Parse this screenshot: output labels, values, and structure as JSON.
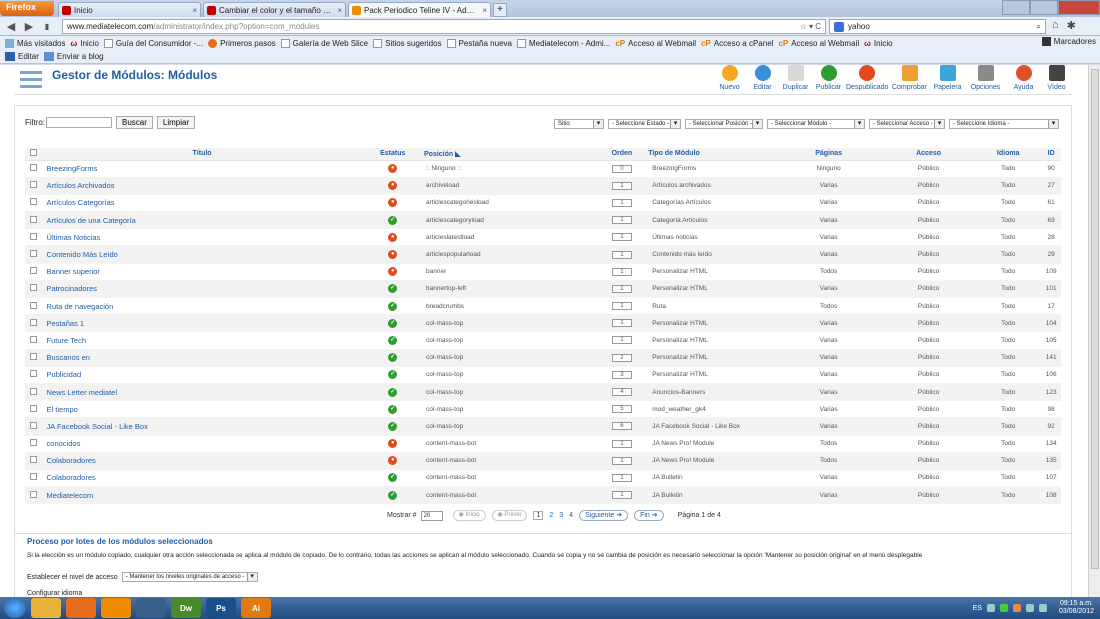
{
  "browser": {
    "app_button": "Firefox",
    "tabs": [
      {
        "title": "Inicio",
        "icon": "w-icon",
        "color": "#c00000"
      },
      {
        "title": "Cambiar el color y el tamaño del men...",
        "icon": "w-icon",
        "color": "#c00000"
      },
      {
        "title": "Pack Periodico Teline IV - Administra...",
        "icon": "joomla-icon",
        "color": "#f28b00",
        "active": true
      }
    ],
    "url_host": "www.mediatelecom.com",
    "url_path": "/administrator/index.php?option=com_modules",
    "search_value": "yahoo",
    "bookmarks": [
      "Más visitados",
      "Inicio",
      "Guía del Consumidor -...",
      "Primeros pasos",
      "Galería de Web Slice",
      "Sitios sugeridos",
      "Pestaña nueva",
      "Mediatelecom - Admi...",
      "Acceso al Webmail",
      "Acceso a cPanel",
      "Acceso al Webmail",
      "Inicio"
    ],
    "bookmarks_menu": "Marcadores",
    "toolbar2": [
      "Editar",
      "Enviar a blog"
    ]
  },
  "header": {
    "title": "Gestor de Módulos: Módulos",
    "buttons": [
      {
        "label": "Nuevo",
        "icon": "plus-icon",
        "color": "#f5a623"
      },
      {
        "label": "Editar",
        "icon": "edit-icon",
        "color": "#3b8fd9"
      },
      {
        "label": "Duplicar",
        "icon": "copy-icon",
        "color": "#bbbbbb"
      },
      {
        "label": "Publicar",
        "icon": "check-icon",
        "color": "#2f9d2f"
      },
      {
        "label": "Despublicado",
        "icon": "unpublish-icon",
        "color": "#e04a1c"
      },
      {
        "label": "Comprobar",
        "icon": "checkmark-icon",
        "color": "#f0a030"
      },
      {
        "label": "Papelera",
        "icon": "trash-icon",
        "color": "#3aa7d8"
      },
      {
        "label": "Opciones",
        "icon": "options-icon",
        "color": "#8a8a8a"
      },
      {
        "label": "Ayuda",
        "icon": "help-icon",
        "color": "#e0502a"
      },
      {
        "label": "Vídeo",
        "icon": "video-icon",
        "color": "#444444"
      }
    ]
  },
  "filter": {
    "label": "Filtro:",
    "value": "",
    "search_button": "Buscar",
    "clear_button": "Limpiar",
    "selects": [
      "Sitio",
      "- Seleccione Estado -",
      "- Seleccionar Posición -",
      "- Seleccionar Módulo -",
      "- Seleccionar Acceso -",
      "- Seleccione Idioma -"
    ]
  },
  "table": {
    "columns": [
      "Título",
      "Estatus",
      "Posición",
      "Orden",
      "Tipo de Módulo",
      "Páginas",
      "Acceso",
      "Idioma",
      "ID"
    ],
    "rows": [
      {
        "title": "BreezingForms",
        "status": "off",
        "position": ":: Ninguno ::",
        "order": "0",
        "type": "BreezingForms",
        "pages": "Ninguno",
        "access": "Público",
        "lang": "Todo",
        "id": "90"
      },
      {
        "title": "Artículos Archivados",
        "status": "off",
        "position": "archiveload",
        "order": "1",
        "type": "Artículos archivados",
        "pages": "Varias",
        "access": "Público",
        "lang": "Todo",
        "id": "27"
      },
      {
        "title": "Artículos Categorías",
        "status": "off",
        "position": "articlescategoriesload",
        "order": "1",
        "type": "Categorías Artículos",
        "pages": "Varias",
        "access": "Público",
        "lang": "Todo",
        "id": "61"
      },
      {
        "title": "Artículos de una Categoría",
        "status": "on",
        "position": "articlescategoryload",
        "order": "1",
        "type": "Categoría Artículos",
        "pages": "Varias",
        "access": "Público",
        "lang": "Todo",
        "id": "69"
      },
      {
        "title": "Últimas Noticias",
        "status": "off",
        "position": "articleslatestload",
        "order": "1",
        "type": "Últimas noticias",
        "pages": "Varias",
        "access": "Público",
        "lang": "Todo",
        "id": "28"
      },
      {
        "title": "Contenido Más Leído",
        "status": "off",
        "position": "articlespopularload",
        "order": "1",
        "type": "Contenido más leído",
        "pages": "Varias",
        "access": "Público",
        "lang": "Todo",
        "id": "29"
      },
      {
        "title": "Banner superior",
        "status": "off",
        "position": "banner",
        "order": "1",
        "type": "Personalizar HTML",
        "pages": "Todos",
        "access": "Público",
        "lang": "Todo",
        "id": "109"
      },
      {
        "title": "Patrocinadores",
        "status": "on",
        "position": "bannertop-left",
        "order": "1",
        "type": "Personalizar HTML",
        "pages": "Varias",
        "access": "Público",
        "lang": "Todo",
        "id": "101"
      },
      {
        "title": "Ruta de navegación",
        "status": "on",
        "position": "breadcrumbs",
        "order": "1",
        "type": "Ruta",
        "pages": "Todos",
        "access": "Público",
        "lang": "Todo",
        "id": "17"
      },
      {
        "title": "Pestañas 1",
        "status": "on",
        "position": "col-mass-top",
        "order": "1",
        "type": "Personalizar HTML",
        "pages": "Varias",
        "access": "Público",
        "lang": "Todo",
        "id": "104"
      },
      {
        "title": "Future Tech",
        "status": "on",
        "position": "col-mass-top",
        "order": "1",
        "type": "Personalizar HTML",
        "pages": "Varias",
        "access": "Público",
        "lang": "Todo",
        "id": "105"
      },
      {
        "title": "Buscanos en",
        "status": "on",
        "position": "col-mass-top",
        "order": "2",
        "type": "Personalizar HTML",
        "pages": "Varias",
        "access": "Público",
        "lang": "Todo",
        "id": "141"
      },
      {
        "title": "Publicidad",
        "status": "on",
        "position": "col-mass-top",
        "order": "3",
        "type": "Personalizar HTML",
        "pages": "Varias",
        "access": "Público",
        "lang": "Todo",
        "id": "106"
      },
      {
        "title": "News Letter mediatel",
        "status": "on",
        "position": "col-mass-top",
        "order": "4",
        "type": "Anuncios-Banners",
        "pages": "Varias",
        "access": "Público",
        "lang": "Todo",
        "id": "123"
      },
      {
        "title": "El tiempo",
        "status": "on",
        "position": "col-mass-top",
        "order": "5",
        "type": "mod_weather_gk4",
        "pages": "Varias",
        "access": "Público",
        "lang": "Todo",
        "id": "98"
      },
      {
        "title": "JA Facebook Social - Like Box",
        "status": "on",
        "position": "col-mass-top",
        "order": "6",
        "type": "JA Facebook Social - Like Box",
        "pages": "Varias",
        "access": "Público",
        "lang": "Todo",
        "id": "92"
      },
      {
        "title": "conocidos",
        "status": "off",
        "position": "content-mass-bot",
        "order": "1",
        "type": "JA News Pro! Module",
        "pages": "Todos",
        "access": "Público",
        "lang": "Todo",
        "id": "134"
      },
      {
        "title": "Colaboradores",
        "status": "off",
        "position": "content-mass-bot",
        "order": "1",
        "type": "JA News Pro! Module",
        "pages": "Todos",
        "access": "Público",
        "lang": "Todo",
        "id": "135"
      },
      {
        "title": "Colaboradores",
        "status": "on",
        "position": "content-mass-bot",
        "order": "1",
        "type": "JA Bulletin",
        "pages": "Varias",
        "access": "Público",
        "lang": "Todo",
        "id": "107"
      },
      {
        "title": "Mediatelecom",
        "status": "on",
        "position": "content-mass-bot",
        "order": "1",
        "type": "JA Bulletin",
        "pages": "Varias",
        "access": "Público",
        "lang": "Todo",
        "id": "108"
      }
    ]
  },
  "pagination": {
    "show_label": "Mostrar #",
    "show_value": "20",
    "start": "Inicio",
    "prev": "Previo",
    "pages": [
      "1",
      "2",
      "3",
      "4"
    ],
    "current": "1",
    "next": "Siguiente",
    "end": "Fin",
    "info": "Página 1 de 4"
  },
  "batch": {
    "title": "Proceso por lotes de los módulos seleccionados",
    "description": "Si la elección es un módulo copiado, cualquier otra acción seleccionada se aplica al módulo de copiado. De lo contrario, todas las acciones se aplican al módulo seleccionado. Cuando se copia y no se cambia de posición es necesario seleccionar la opción 'Mantener su posición original' en el menú desplegable",
    "access_label": "Establecer el nivel de acceso",
    "access_value": "- Mantener los niveles originales de acceso -",
    "lang_label": "Configurar idioma"
  },
  "taskbar": {
    "apps": [
      {
        "name": "explorer",
        "label": "",
        "color": "#e8b23a"
      },
      {
        "name": "firefox",
        "label": "",
        "color": "#e46c1a"
      },
      {
        "name": "media",
        "label": "",
        "color": "#f08a00"
      },
      {
        "name": "itunes",
        "label": "",
        "color": "#3a5e8a"
      },
      {
        "name": "dreamweaver",
        "label": "Dw",
        "color": "#4a8a2a"
      },
      {
        "name": "photoshop",
        "label": "Ps",
        "color": "#1a4f8a"
      },
      {
        "name": "illustrator",
        "label": "Ai",
        "color": "#e07a10"
      }
    ],
    "lang": "ES",
    "time": "09:15 a.m.",
    "date": "03/08/2012"
  }
}
